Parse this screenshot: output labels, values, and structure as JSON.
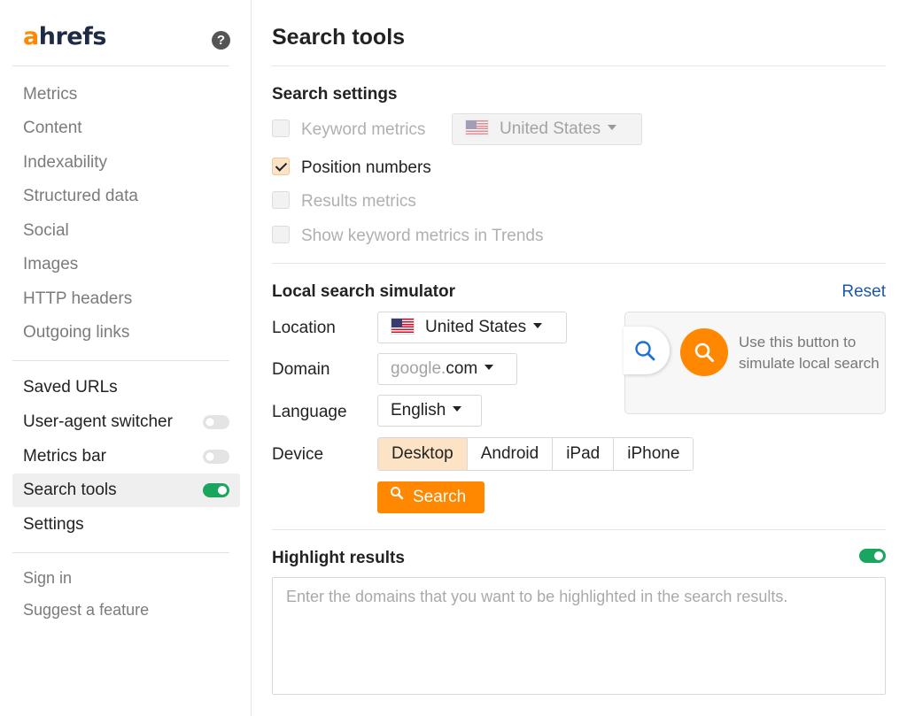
{
  "sidebar": {
    "logo": {
      "accent_letter": "a",
      "rest": "hrefs",
      "accent_color": "#ff8800"
    },
    "help_icon": "question-icon",
    "help_glyph": "?",
    "nav_items": [
      {
        "label": "Metrics"
      },
      {
        "label": "Content"
      },
      {
        "label": "Indexability"
      },
      {
        "label": "Structured data"
      },
      {
        "label": "Social"
      },
      {
        "label": "Images"
      },
      {
        "label": "HTTP headers"
      },
      {
        "label": "Outgoing links"
      }
    ],
    "tool_items": [
      {
        "label": "Saved URLs"
      },
      {
        "label": "User-agent switcher",
        "toggle": false
      },
      {
        "label": "Metrics bar",
        "toggle": false
      },
      {
        "label": "Search tools",
        "toggle": true,
        "active": true
      },
      {
        "label": "Settings"
      }
    ],
    "footer_items": [
      {
        "label": "Sign in"
      },
      {
        "label": "Suggest a feature"
      }
    ]
  },
  "main": {
    "title": "Search tools",
    "search_settings": {
      "title": "Search settings",
      "options": [
        {
          "label": "Keyword metrics",
          "checked": false,
          "enabled": false
        },
        {
          "label": "Position numbers",
          "checked": true,
          "enabled": true
        },
        {
          "label": "Results metrics",
          "checked": false,
          "enabled": false
        },
        {
          "label": "Show keyword metrics in Trends",
          "checked": false,
          "enabled": false
        }
      ],
      "keyword_country": "United States",
      "keyword_country_flag": "us-flag-icon"
    },
    "local_simulator": {
      "title": "Local search simulator",
      "reset_label": "Reset",
      "location_label": "Location",
      "location_value": "United States",
      "domain_label": "Domain",
      "domain_prefix": "google.",
      "domain_suffix": "com",
      "language_label": "Language",
      "language_value": "English",
      "device_label": "Device",
      "devices": [
        "Desktop",
        "Android",
        "iPad",
        "iPhone"
      ],
      "selected_device": "Desktop",
      "search_button_label": "Search",
      "hint_text": "Use this button to simulate local search"
    },
    "highlight": {
      "title": "Highlight results",
      "enabled": true,
      "placeholder": "Enter the domains that you want to be highlighted in the search results."
    }
  },
  "colors": {
    "accent": "#ff8800",
    "toggle_on": "#1ba65f",
    "link": "#1d58a8",
    "selected_bg": "#fde3c6"
  }
}
